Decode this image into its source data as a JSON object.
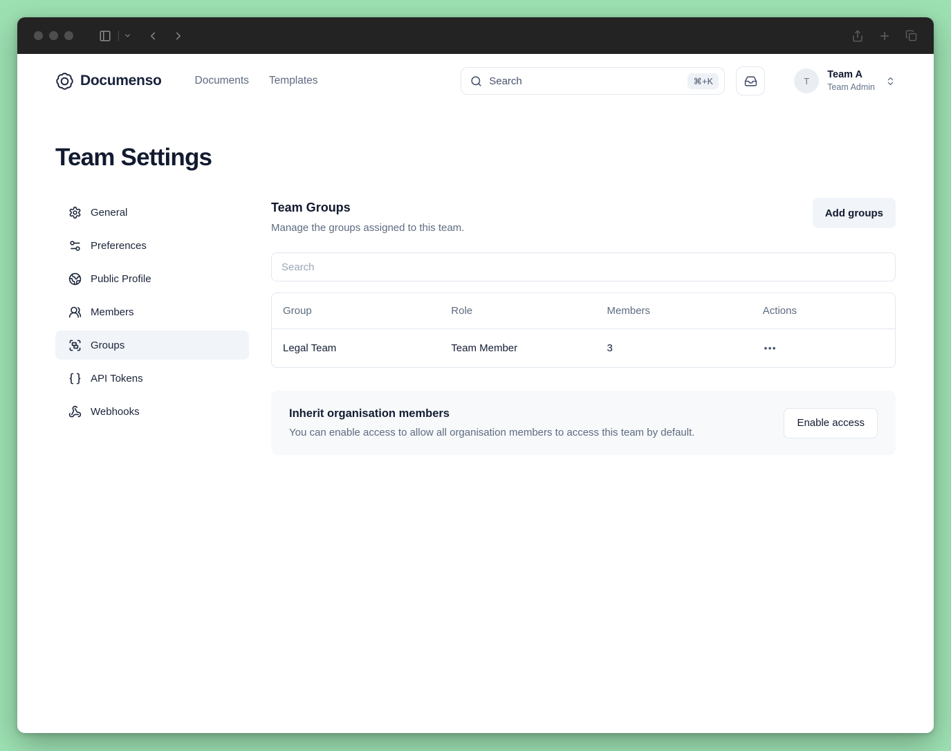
{
  "colors": {
    "desktop_background": "#9de1b2",
    "titlebar": "#232323",
    "text_primary": "#10192e",
    "text_secondary": "#5d6b80",
    "border": "#e1e7ef",
    "muted_bg": "#f1f4f8",
    "panel_bg": "#f7f9fb"
  },
  "header": {
    "brand": "Documenso",
    "nav": [
      {
        "label": "Documents"
      },
      {
        "label": "Templates"
      }
    ],
    "search": {
      "placeholder": "Search",
      "shortcut": "⌘+K"
    },
    "account": {
      "initial": "T",
      "name": "Team A",
      "role": "Team Admin"
    }
  },
  "page": {
    "title": "Team Settings"
  },
  "sidebar": {
    "items": [
      {
        "label": "General",
        "icon": "gear-icon",
        "active": false
      },
      {
        "label": "Preferences",
        "icon": "sliders-icon",
        "active": false
      },
      {
        "label": "Public Profile",
        "icon": "globe-icon",
        "active": false
      },
      {
        "label": "Members",
        "icon": "users-icon",
        "active": false
      },
      {
        "label": "Groups",
        "icon": "group-icon",
        "active": true
      },
      {
        "label": "API Tokens",
        "icon": "braces-icon",
        "active": false
      },
      {
        "label": "Webhooks",
        "icon": "webhook-icon",
        "active": false
      }
    ]
  },
  "main": {
    "section_title": "Team Groups",
    "section_description": "Manage the groups assigned to this team.",
    "add_button": "Add groups",
    "filter_placeholder": "Search",
    "table": {
      "columns": [
        "Group",
        "Role",
        "Members",
        "Actions"
      ],
      "rows": [
        {
          "group": "Legal Team",
          "role": "Team Member",
          "members": "3",
          "actions": "•••"
        }
      ]
    },
    "inherit": {
      "title": "Inherit organisation members",
      "description": "You can enable access to allow all organisation members to access this team by default.",
      "button": "Enable access"
    }
  }
}
